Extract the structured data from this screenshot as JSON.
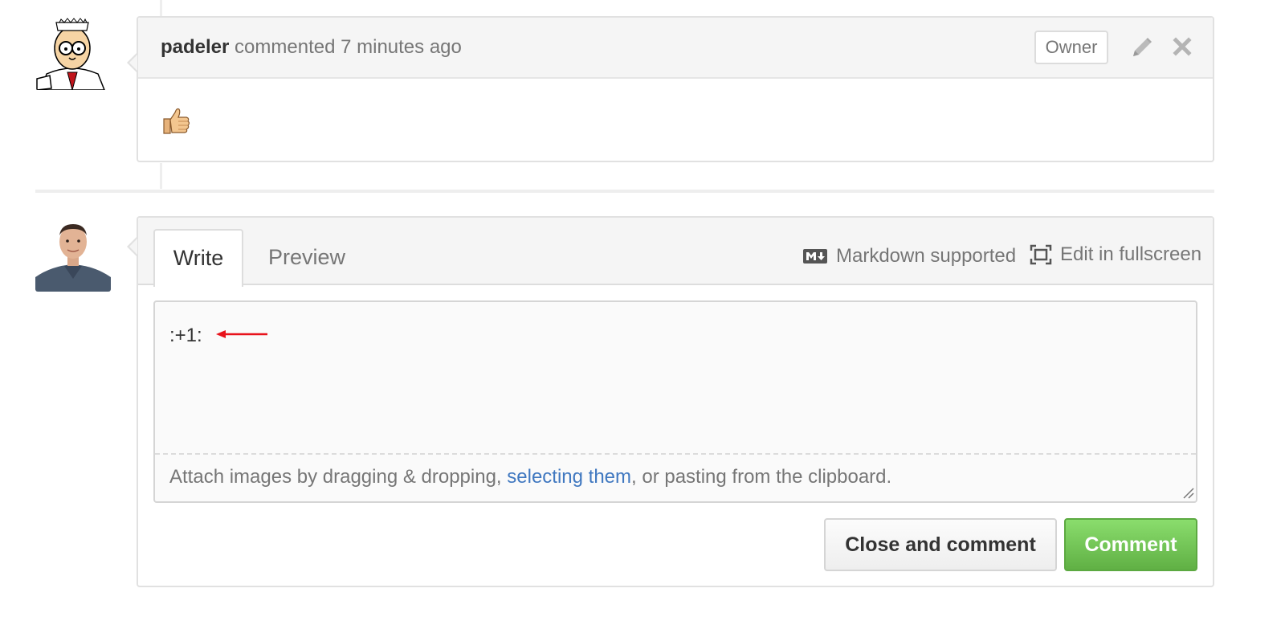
{
  "comment": {
    "author": "padeler",
    "meta_text": " commented 7 minutes ago",
    "badge": "Owner",
    "body_emoji": "👍",
    "edit_icon": "pencil-icon",
    "delete_icon": "x-icon"
  },
  "form": {
    "tabs": [
      {
        "label": "Write",
        "selected": true
      },
      {
        "label": "Preview",
        "selected": false
      }
    ],
    "markdown_hint": "Markdown supported",
    "fullscreen_label": "Edit in fullscreen",
    "textarea_value": ":+1:",
    "attach_prefix": "Attach images by dragging & dropping, ",
    "attach_link": "selecting them",
    "attach_suffix": ", or pasting from the clipboard.",
    "close_button": "Close and comment",
    "comment_button": "Comment"
  },
  "colors": {
    "accent_green": "#60b044",
    "link_blue": "#4078c0",
    "annotation_red": "#e8121b"
  }
}
